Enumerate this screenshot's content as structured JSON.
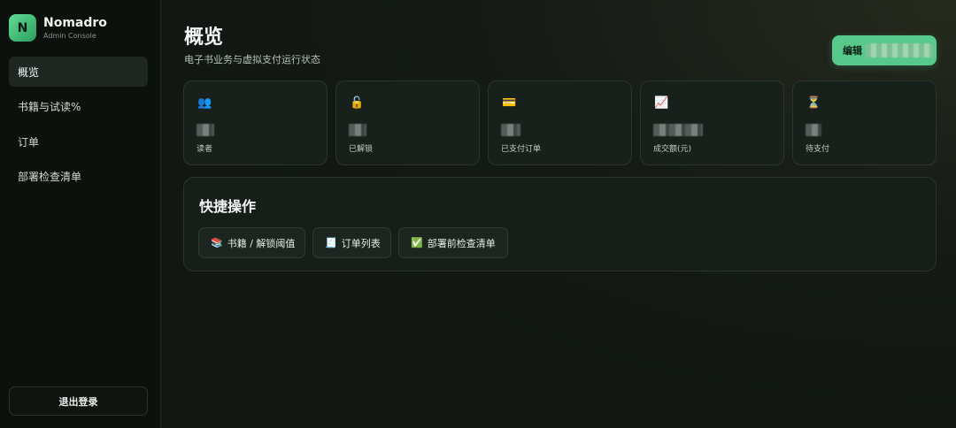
{
  "brand": {
    "name": "Nomadro",
    "subtitle": "Admin Console",
    "logo_letter": "N"
  },
  "sidebar": {
    "items": [
      {
        "label": "概览",
        "active": true
      },
      {
        "label": "书籍与试读%"
      },
      {
        "label": "订单"
      },
      {
        "label": "部署检查清单"
      }
    ],
    "logout_label": "退出登录"
  },
  "header": {
    "title": "概览",
    "subtitle": "电子书业务与虚拟支付运行状态",
    "edit_label": "编辑"
  },
  "stats": [
    {
      "icon": "readers-icon",
      "glyph": "👥",
      "label": "读者"
    },
    {
      "icon": "unlock-icon",
      "glyph": "🔓",
      "label": "已解锁"
    },
    {
      "icon": "credit-card-icon",
      "glyph": "💳",
      "label": "已支付订单"
    },
    {
      "icon": "trend-chart-icon",
      "glyph": "📈",
      "label": "成交额(元)"
    },
    {
      "icon": "hourglass-icon",
      "glyph": "⏳",
      "label": "待支付"
    }
  ],
  "quick_actions": {
    "title": "快捷操作",
    "buttons": [
      {
        "icon": "books-icon",
        "glyph": "📚",
        "label": "书籍 / 解锁阈值"
      },
      {
        "icon": "receipt-icon",
        "glyph": "🧾",
        "label": "订单列表"
      },
      {
        "icon": "checkbox-icon",
        "glyph": "✅",
        "label": "部署前检查清单"
      }
    ]
  },
  "colors": {
    "accent": "#57c98a",
    "background": "#101512",
    "card": "#18201b"
  }
}
